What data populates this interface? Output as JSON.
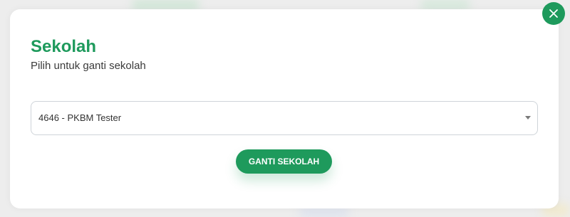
{
  "modal": {
    "title": "Sekolah",
    "subtitle": "Pilih untuk ganti sekolah",
    "close_icon": "close-icon"
  },
  "school_select": {
    "selected_value": "4646 - PKBM Tester",
    "caret_icon": "caret-down-icon"
  },
  "actions": {
    "submit_label": "GANTI SEKOLAH"
  },
  "colors": {
    "accent": "#1e9a5c",
    "overlay_background": "#ededed",
    "modal_background": "#ffffff"
  }
}
